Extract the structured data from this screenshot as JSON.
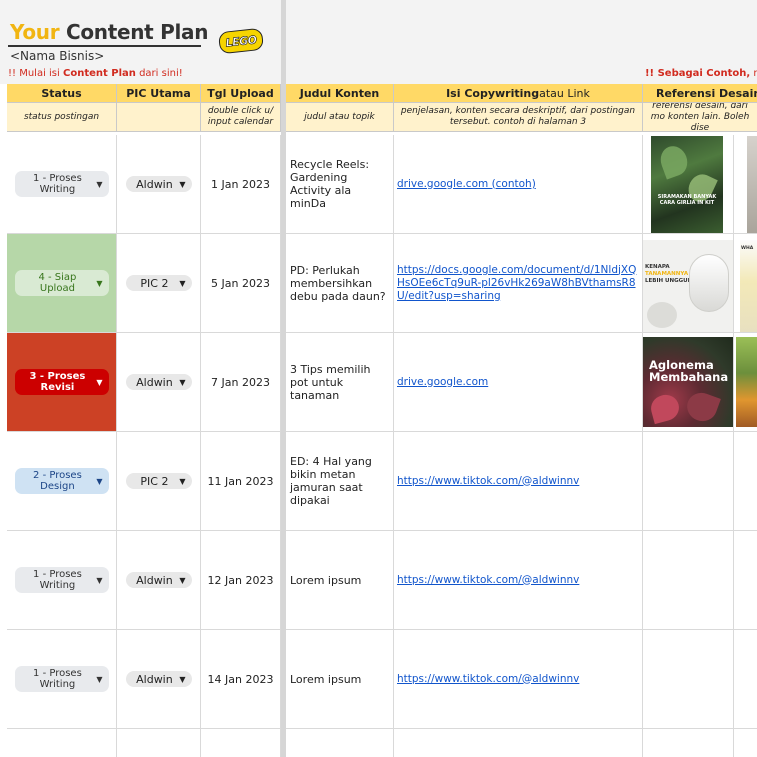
{
  "header": {
    "title_your": "Your",
    "title_rest": " Content Plan",
    "business": "<Nama Bisnis>",
    "logo_text": "LEGO",
    "notice_left_prefix": "!! Mulai isi ",
    "notice_left_bold": "Content Plan",
    "notice_left_suffix": " dari sini!",
    "notice_right_bold": "!! Sebagai Contoh,",
    "notice_right_suffix": " mod"
  },
  "columns": {
    "status": "Status",
    "pic": "PIC Utama",
    "tgl": "Tgl Upload",
    "judul": "Judul Konten",
    "isi_bold": "Isi Copywriting",
    "isi_light": " atau Link",
    "ref": "Referensi Desain (In"
  },
  "subheaders": {
    "status": "status postingan",
    "pic": "",
    "tgl": "double click u/ input calendar",
    "judul": "judul atau topik",
    "isi": "penjelasan, konten secara deskriptif, dari postingan tersebut. contoh di halaman 3",
    "ref": "referensi desain, dari mo konten lain. Boleh dise"
  },
  "rows": [
    {
      "status": "1 - Proses Writing",
      "pic": "Aldwin",
      "date": "1 Jan 2023",
      "title": "Recycle Reels: Gardening Activity ala minDa",
      "link": "drive.google.com (contoh)"
    },
    {
      "status": "4 - Siap Upload",
      "pic": "PIC 2",
      "date": "5 Jan 2023",
      "title": "PD: Perlukah membersihkan debu pada daun?",
      "link": "https://docs.google.com/document/d/1NldjXQHsOEe6cTq9uR-pl26vHk269aW8hBVthamsR8U/edit?usp=sharing"
    },
    {
      "status": "3 - Proses Revisi",
      "pic": "Aldwin",
      "date": "7 Jan 2023",
      "title": "3 Tips memilih pot untuk tanaman",
      "link": "drive.google.com"
    },
    {
      "status": "2 - Proses Design",
      "pic": "PIC 2",
      "date": "11 Jan 2023",
      "title": "ED: 4 Hal yang bikin metan jamuran saat dipakai",
      "link": "https://www.tiktok.com/@aldwinnv"
    },
    {
      "status": "1 - Proses Writing",
      "pic": "Aldwin",
      "date": "12 Jan 2023",
      "title": "Lorem ipsum",
      "link": "https://www.tiktok.com/@aldwinnv"
    },
    {
      "status": "1 - Proses Writing",
      "pic": "Aldwin",
      "date": "14 Jan 2023",
      "title": "Lorem ipsum",
      "link": "https://www.tiktok.com/@aldwinnv"
    }
  ],
  "thumb_text": {
    "t1": "SIRAMAKAN BANYAK CARA GIRLIA IN KIT",
    "t2a": "KENAPA",
    "t2b": "TANAMANNYA ?",
    "t2c": "LEBIH UNGGUL?",
    "t2d": "WHA",
    "t3": "Aglonema Membahana"
  },
  "colors": {
    "writing_bg": "#e8eaed",
    "writing_fg": "#333333",
    "upload_bg": "#d9ead3",
    "upload_fg": "#38761d",
    "upload_cell": "#b6d7a8",
    "revisi_bg": "#cc0000",
    "revisi_fg": "#ffffff",
    "revisi_cell": "#cc4125",
    "design_bg": "#cfe2f3",
    "design_fg": "#1c4587",
    "header_yellow": "#ffd966",
    "subheader_yellow": "#fff2cc"
  }
}
